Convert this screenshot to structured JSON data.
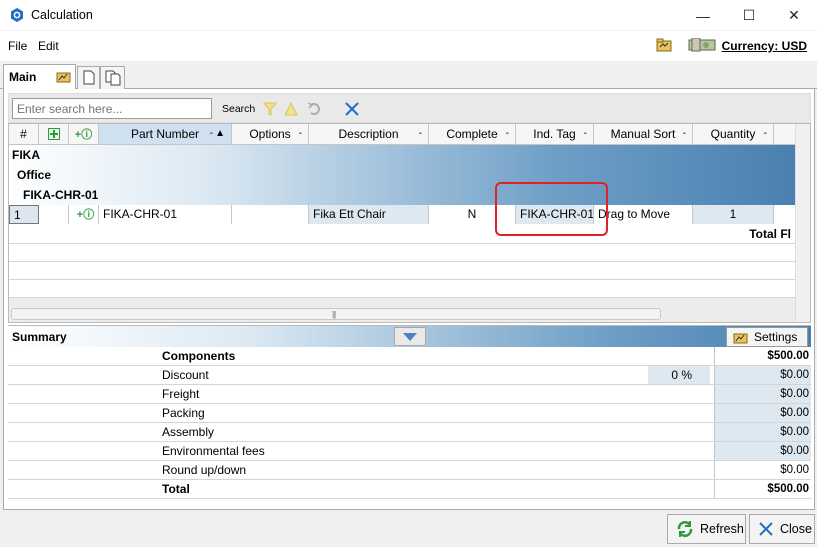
{
  "window": {
    "title": "Calculation",
    "controls": {
      "minimize": "—",
      "maximize": "☐",
      "close": "✕"
    }
  },
  "menu": {
    "file": "File",
    "edit": "Edit",
    "currency": "Currency: USD"
  },
  "tabs": {
    "main": "Main"
  },
  "search": {
    "placeholder": "Enter search here...",
    "search_label": "Search"
  },
  "grid": {
    "columns": [
      "#",
      "",
      "",
      "Part Number",
      "Options",
      "Description",
      "Complete",
      "Ind. Tag",
      "Manual Sort",
      "Quantity"
    ],
    "groups": [
      "FIKA",
      "Office",
      "FIKA-CHR-01"
    ],
    "row": {
      "num": "1",
      "part_number": "FIKA-CHR-01",
      "options": "",
      "description": "Fika Ett Chair",
      "complete": "N",
      "ind_tag": "FIKA-CHR-01",
      "manual_sort": "Drag to Move",
      "quantity": "1"
    },
    "total_label": "Total Fl"
  },
  "summary": {
    "title": "Summary",
    "settings_label": "Settings",
    "rows": [
      {
        "name": "Components",
        "value": "$500.00",
        "bold": true
      },
      {
        "name": "Discount",
        "pct": "0 %",
        "value": "$0.00"
      },
      {
        "name": "Freight",
        "value": "$0.00"
      },
      {
        "name": "Packing",
        "value": "$0.00"
      },
      {
        "name": "Assembly",
        "value": "$0.00"
      },
      {
        "name": "Environmental fees",
        "value": "$0.00"
      },
      {
        "name": "Round up/down",
        "value": "$0.00"
      },
      {
        "name": "Total",
        "value": "$500.00",
        "bold": true
      }
    ]
  },
  "buttons": {
    "refresh": "Refresh",
    "close": "Close"
  },
  "colors": {
    "accent_blue": "#4a80b0",
    "highlight_red": "#e0202a",
    "refresh_green": "#2e9a3c",
    "close_blue": "#1f6fc4"
  }
}
